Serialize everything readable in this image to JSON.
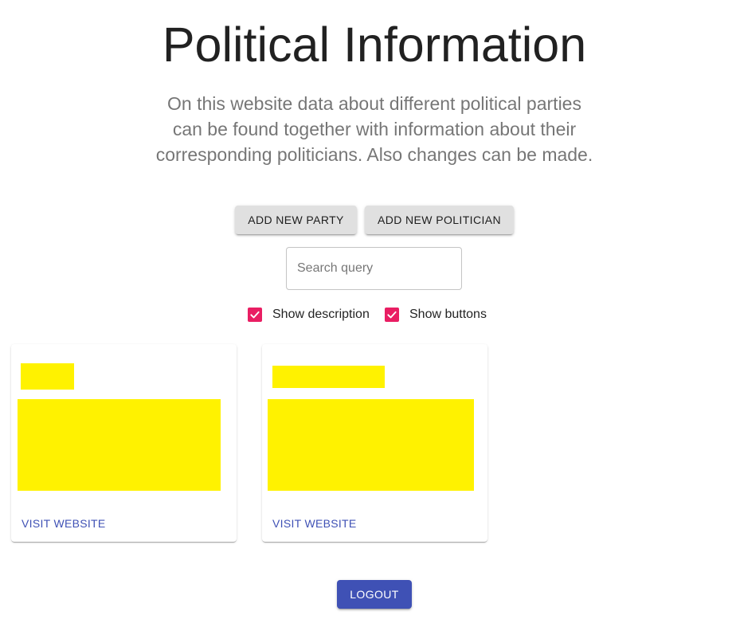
{
  "header": {
    "title": "Political Information",
    "intro": "On this website data about different political parties can be found together with information about their corresponding politicians. Also changes can be made."
  },
  "actions": {
    "add_party_label": "ADD NEW PARTY",
    "add_politician_label": "ADD NEW POLITICIAN"
  },
  "search": {
    "placeholder": "Search query",
    "value": ""
  },
  "filters": [
    {
      "label": "Show description",
      "checked": true
    },
    {
      "label": "Show buttons",
      "checked": true
    }
  ],
  "cards": [
    {
      "link_label": "VISIT WEBSITE"
    },
    {
      "link_label": "VISIT WEBSITE"
    }
  ],
  "footer": {
    "logout_label": "LOGOUT"
  },
  "colors": {
    "primary": "#3f51b5",
    "checkbox": "#e91e63",
    "redaction": "#fff200"
  }
}
